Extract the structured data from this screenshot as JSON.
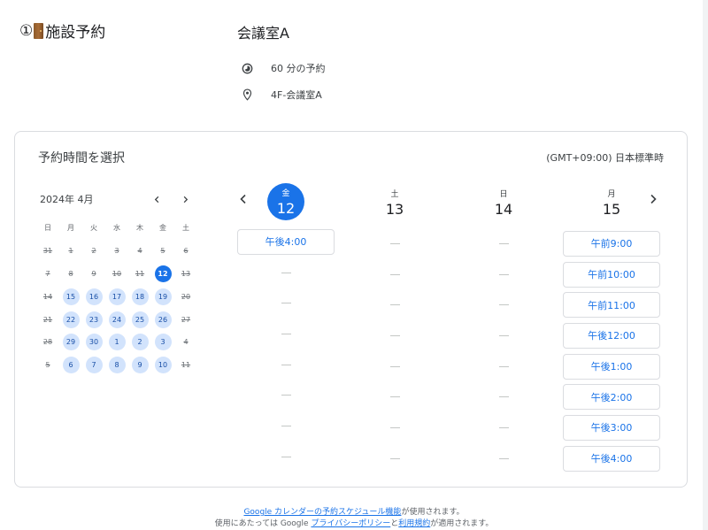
{
  "header": {
    "title_prefix": "①",
    "title_text": "施設予約"
  },
  "room": {
    "name": "会議室A",
    "duration": "60 分の予約",
    "location": "4F-会議室A"
  },
  "card": {
    "title": "予約時間を選択",
    "timezone": "(GMT+09:00) 日本標準時"
  },
  "mini_calendar": {
    "month_label": "2024年 4月",
    "weekdays": [
      "日",
      "月",
      "火",
      "水",
      "木",
      "金",
      "土"
    ],
    "days": [
      {
        "label": "31",
        "state": "unavail"
      },
      {
        "label": "1",
        "state": "unavail"
      },
      {
        "label": "2",
        "state": "unavail"
      },
      {
        "label": "3",
        "state": "unavail"
      },
      {
        "label": "4",
        "state": "unavail"
      },
      {
        "label": "5",
        "state": "unavail"
      },
      {
        "label": "6",
        "state": "unavail"
      },
      {
        "label": "7",
        "state": "unavail"
      },
      {
        "label": "8",
        "state": "unavail"
      },
      {
        "label": "9",
        "state": "unavail"
      },
      {
        "label": "10",
        "state": "unavail"
      },
      {
        "label": "11",
        "state": "unavail"
      },
      {
        "label": "12",
        "state": "selected"
      },
      {
        "label": "13",
        "state": "unavail"
      },
      {
        "label": "14",
        "state": "unavail"
      },
      {
        "label": "15",
        "state": "avail"
      },
      {
        "label": "16",
        "state": "avail"
      },
      {
        "label": "17",
        "state": "avail"
      },
      {
        "label": "18",
        "state": "avail"
      },
      {
        "label": "19",
        "state": "avail"
      },
      {
        "label": "20",
        "state": "unavail"
      },
      {
        "label": "21",
        "state": "unavail"
      },
      {
        "label": "22",
        "state": "avail"
      },
      {
        "label": "23",
        "state": "avail"
      },
      {
        "label": "24",
        "state": "avail"
      },
      {
        "label": "25",
        "state": "avail"
      },
      {
        "label": "26",
        "state": "avail"
      },
      {
        "label": "27",
        "state": "unavail"
      },
      {
        "label": "28",
        "state": "unavail"
      },
      {
        "label": "29",
        "state": "avail"
      },
      {
        "label": "30",
        "state": "avail"
      },
      {
        "label": "1",
        "state": "avail"
      },
      {
        "label": "2",
        "state": "avail"
      },
      {
        "label": "3",
        "state": "avail"
      },
      {
        "label": "4",
        "state": "unavail"
      },
      {
        "label": "5",
        "state": "unavail"
      },
      {
        "label": "6",
        "state": "avail"
      },
      {
        "label": "7",
        "state": "avail"
      },
      {
        "label": "8",
        "state": "avail"
      },
      {
        "label": "9",
        "state": "avail"
      },
      {
        "label": "10",
        "state": "avail"
      },
      {
        "label": "11",
        "state": "unavail"
      }
    ]
  },
  "week": {
    "days": [
      {
        "dow": "金",
        "num": "12",
        "selected": true,
        "slots": [
          "午後4:00",
          "",
          "",
          "",
          "",
          "",
          "",
          ""
        ]
      },
      {
        "dow": "土",
        "num": "13",
        "selected": false,
        "slots": [
          "",
          "",
          "",
          "",
          "",
          "",
          "",
          ""
        ]
      },
      {
        "dow": "日",
        "num": "14",
        "selected": false,
        "slots": [
          "",
          "",
          "",
          "",
          "",
          "",
          "",
          ""
        ]
      },
      {
        "dow": "月",
        "num": "15",
        "selected": false,
        "slots": [
          "午前9:00",
          "午前10:00",
          "午前11:00",
          "午後12:00",
          "午後1:00",
          "午後2:00",
          "午後3:00",
          "午後4:00"
        ]
      }
    ]
  },
  "footer": {
    "line1_link": "Google カレンダーの予約スケジュール機能",
    "line1_text": "が使用されます。",
    "line2_prefix": "使用にあたっては Google ",
    "privacy_link": "プライバシーポリシー",
    "and_text": "と",
    "terms_link": "利用規約",
    "line2_suffix": "が適用されます。"
  },
  "colors": {
    "accent": "#1a73e8",
    "available_bg": "#d2e3fc",
    "border": "#dadce0"
  },
  "icons": {
    "duration": "clock-icon",
    "location": "location-pin-icon",
    "prev": "chevron-left-icon",
    "next": "chevron-right-icon"
  }
}
